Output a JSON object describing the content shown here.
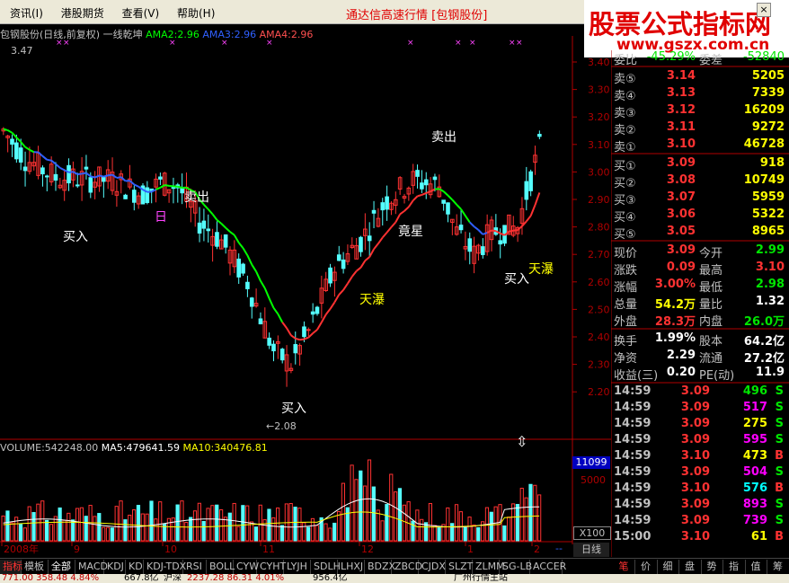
{
  "menubar": {
    "items": [
      "资讯(I)",
      "港股期货",
      "查看(V)",
      "帮助(H)"
    ],
    "app_title": "通达信高速行情 [包钢股份]",
    "close_label": "×"
  },
  "logo": {
    "line1": "股票公式指标网",
    "line2": "www.gszx.com.cn"
  },
  "chart_header": {
    "stock": "包钢股份(日线,前复权) 一线乾坤",
    "ama2": "AMA2:2.96",
    "ama3": "AMA3:2.96",
    "ama4": "AMA4:2.96",
    "max_mark": "3.47",
    "min_mark": "←2.08"
  },
  "annotations": [
    {
      "text": "买入",
      "color": "#ffffff"
    },
    {
      "text": "卖出",
      "color": "#ffffff"
    },
    {
      "text": "日",
      "color": "#ff44ff"
    },
    {
      "text": "买入",
      "color": "#ffffff"
    },
    {
      "text": "天瀑",
      "color": "#ffff00"
    },
    {
      "text": "竟星",
      "color": "#ffffff"
    },
    {
      "text": "卖出",
      "color": "#ffffff"
    },
    {
      "text": "买入",
      "color": "#ffffff"
    },
    {
      "text": "天瀑",
      "color": "#ffff00"
    }
  ],
  "y_axis": [
    "3.40",
    "3.30",
    "3.20",
    "3.10",
    "3.00",
    "2.90",
    "2.80",
    "2.70",
    "2.60",
    "2.50",
    "2.40",
    "2.30",
    "2.20"
  ],
  "vol_header": {
    "volume": "VOLUME:542248.00",
    "ma5": "MA5:479641.59",
    "ma10": "MA10:340476.81"
  },
  "vol_axis": {
    "top": "11099",
    "mid": "5000",
    "unit": "X100"
  },
  "x_axis": [
    "2008年",
    "9",
    "10",
    "11",
    "12",
    "1",
    "2"
  ],
  "period_label": "日线",
  "quote": {
    "weibi_label": "委比",
    "weibi": "-45.29%",
    "weicha_label": "委差",
    "weicha": "-52840",
    "sell": [
      {
        "label": "卖⑤",
        "price": "3.14",
        "vol": "5205"
      },
      {
        "label": "卖④",
        "price": "3.13",
        "vol": "7339"
      },
      {
        "label": "卖③",
        "price": "3.12",
        "vol": "16209"
      },
      {
        "label": "卖②",
        "price": "3.11",
        "vol": "9272"
      },
      {
        "label": "卖①",
        "price": "3.10",
        "vol": "46728"
      }
    ],
    "buy": [
      {
        "label": "买①",
        "price": "3.09",
        "vol": "918"
      },
      {
        "label": "买②",
        "price": "3.08",
        "vol": "10749"
      },
      {
        "label": "买③",
        "price": "3.07",
        "vol": "5959"
      },
      {
        "label": "买④",
        "price": "3.06",
        "vol": "5322"
      },
      {
        "label": "买⑤",
        "price": "3.05",
        "vol": "8965"
      }
    ],
    "stats": [
      {
        "l1": "现价",
        "v1": "3.09",
        "c1": "red",
        "l2": "今开",
        "v2": "2.99",
        "c2": "green"
      },
      {
        "l1": "涨跌",
        "v1": "0.09",
        "c1": "red",
        "l2": "最高",
        "v2": "3.10",
        "c2": "red"
      },
      {
        "l1": "涨幅",
        "v1": "3.00%",
        "c1": "red",
        "l2": "最低",
        "v2": "2.98",
        "c2": "green"
      },
      {
        "l1": "总量",
        "v1": "54.2万",
        "c1": "yellow",
        "l2": "量比",
        "v2": "1.32",
        "c2": "white"
      },
      {
        "l1": "外盘",
        "v1": "28.3万",
        "c1": "red",
        "l2": "内盘",
        "v2": "26.0万",
        "c2": "green"
      },
      {
        "l1": "换手",
        "v1": "1.99%",
        "c1": "white",
        "l2": "股本",
        "v2": "64.2亿",
        "c2": "white"
      },
      {
        "l1": "净资",
        "v1": "2.29",
        "c1": "white",
        "l2": "流通",
        "v2": "27.2亿",
        "c2": "white"
      },
      {
        "l1": "收益(三)",
        "v1": "0.20",
        "c1": "white",
        "l2": "PE(动)",
        "v2": "11.9",
        "c2": "white"
      }
    ],
    "ticks": [
      {
        "time": "14:59",
        "price": "3.09",
        "vol": "496",
        "side": "S"
      },
      {
        "time": "14:59",
        "price": "3.09",
        "vol": "517",
        "side": "S"
      },
      {
        "time": "14:59",
        "price": "3.09",
        "vol": "275",
        "side": "S"
      },
      {
        "time": "14:59",
        "price": "3.09",
        "vol": "595",
        "side": "S"
      },
      {
        "time": "14:59",
        "price": "3.10",
        "vol": "473",
        "side": "B"
      },
      {
        "time": "14:59",
        "price": "3.09",
        "vol": "504",
        "side": "S"
      },
      {
        "time": "14:59",
        "price": "3.10",
        "vol": "576",
        "side": "B"
      },
      {
        "time": "14:59",
        "price": "3.09",
        "vol": "893",
        "side": "S"
      },
      {
        "time": "14:59",
        "price": "3.09",
        "vol": "739",
        "side": "S"
      },
      {
        "time": "15:00",
        "price": "3.10",
        "vol": "61",
        "side": "B"
      }
    ]
  },
  "tabs": [
    "指标",
    "模板",
    "全部",
    "MACD",
    "KDJ",
    "KD",
    "KDJ-TDX",
    "RSI",
    "BOLL",
    "CYW",
    "CYHT",
    "LYJH",
    "SDLH",
    "LHXJ",
    "BDZX",
    "ZBCD",
    "CJDX",
    "SLZT",
    "ZLMM",
    "SG-LB",
    "ACCER"
  ],
  "right_tabs": [
    "笔",
    "价",
    "细",
    "盘",
    "势",
    "指",
    "值",
    "筹"
  ],
  "statusbar": {
    "left": "771.00  358.48  4.84%",
    "mid": "667.8亿",
    "mid2": "沪深",
    "right": "2237.28  86.31  4.01%",
    "right2": "956.4亿",
    "right3": "广州行情主站"
  }
}
